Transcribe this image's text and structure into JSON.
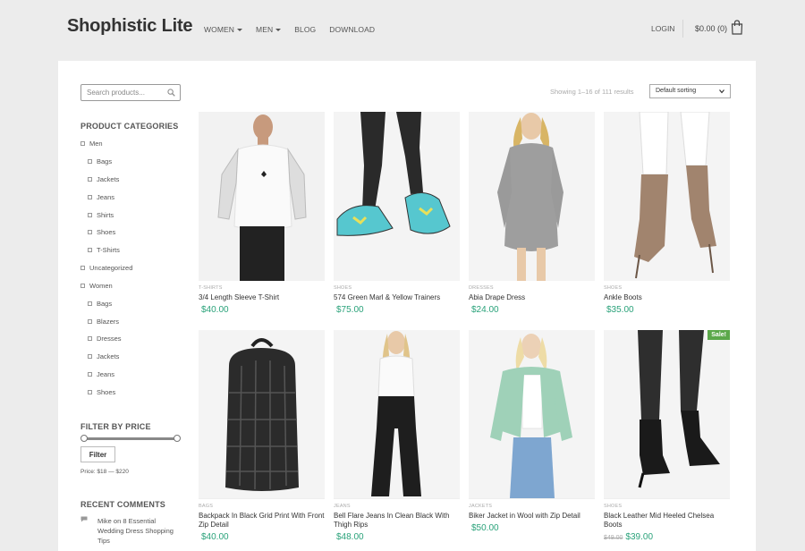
{
  "header": {
    "logo": "Shophistic Lite",
    "nav": [
      {
        "label": "WOMEN",
        "dropdown": true
      },
      {
        "label": "MEN",
        "dropdown": true
      },
      {
        "label": "BLOG",
        "dropdown": false
      },
      {
        "label": "DOWNLOAD",
        "dropdown": false
      }
    ],
    "login": "LOGIN",
    "cart_total": "$0.00 (0)"
  },
  "sidebar": {
    "search_placeholder": "Search products...",
    "categories_title": "PRODUCT CATEGORIES",
    "categories": [
      {
        "label": "Men",
        "level": 0
      },
      {
        "label": "Bags",
        "level": 1
      },
      {
        "label": "Jackets",
        "level": 1
      },
      {
        "label": "Jeans",
        "level": 1
      },
      {
        "label": "Shirts",
        "level": 1
      },
      {
        "label": "Shoes",
        "level": 1
      },
      {
        "label": "T-Shirts",
        "level": 1
      },
      {
        "label": "Uncategorized",
        "level": 0
      },
      {
        "label": "Women",
        "level": 0
      },
      {
        "label": "Bags",
        "level": 1
      },
      {
        "label": "Blazers",
        "level": 1
      },
      {
        "label": "Dresses",
        "level": 1
      },
      {
        "label": "Jackets",
        "level": 1
      },
      {
        "label": "Jeans",
        "level": 1
      },
      {
        "label": "Shoes",
        "level": 1
      }
    ],
    "filter_title": "FILTER BY PRICE",
    "filter_button": "Filter",
    "price_range": "Price: $18 — $220",
    "comments_title": "RECENT COMMENTS",
    "comment": "Mike on 8 Essential Wedding Dress Shopping Tips"
  },
  "toolbar": {
    "result_count": "Showing 1–16 of 111 results",
    "sort_selected": "Default sorting"
  },
  "colors": {
    "price": "#2aa27a",
    "sale_badge": "#5ba84a"
  },
  "products": [
    {
      "category": "T-SHIRTS",
      "name": "3/4 Length Sleeve T-Shirt",
      "price": "$40.00",
      "old_price": "",
      "sale": ""
    },
    {
      "category": "SHOES",
      "name": "574 Green Marl & Yellow Trainers",
      "price": "$75.00",
      "old_price": "",
      "sale": ""
    },
    {
      "category": "DRESSES",
      "name": "Abia Drape Dress",
      "price": "$24.00",
      "old_price": "",
      "sale": ""
    },
    {
      "category": "SHOES",
      "name": "Ankle Boots",
      "price": "$35.00",
      "old_price": "",
      "sale": ""
    },
    {
      "category": "BAGS",
      "name": "Backpack In Black Grid Print With Front Zip Detail",
      "price": "$40.00",
      "old_price": "",
      "sale": ""
    },
    {
      "category": "JEANS",
      "name": "Bell Flare Jeans In Clean Black With Thigh Rips",
      "price": "$48.00",
      "old_price": "",
      "sale": ""
    },
    {
      "category": "JACKETS",
      "name": "Biker Jacket in Wool with Zip Detail",
      "price": "$50.00",
      "old_price": "",
      "sale": ""
    },
    {
      "category": "SHOES",
      "name": "Black Leather Mid Heeled Chelsea Boots",
      "price": "$39.00",
      "old_price": "$49.00",
      "sale": "Sale!"
    }
  ]
}
